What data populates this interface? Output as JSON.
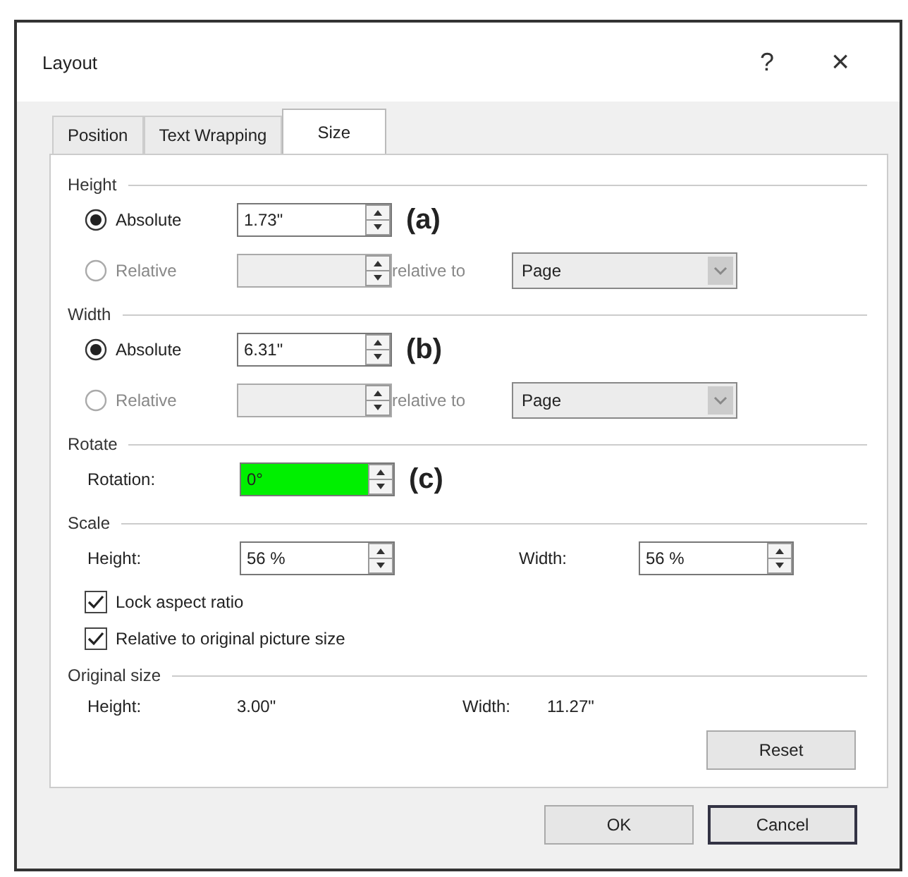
{
  "window": {
    "title": "Layout",
    "help": "?",
    "close": "×"
  },
  "tabs": [
    {
      "label": "Position",
      "selected": false
    },
    {
      "label": "Text Wrapping",
      "selected": false
    },
    {
      "label": "Size",
      "selected": true
    }
  ],
  "sections": [
    {
      "kind": "size",
      "title": "Height",
      "annotation": "(a)",
      "absolute": {
        "label": "Absolute",
        "selected": true,
        "value": "1.73\""
      },
      "relative": {
        "label": "Relative",
        "selected": false,
        "disabled": true
      },
      "relative_to": {
        "label": "relative to",
        "value": "Page",
        "disabled": true
      }
    },
    {
      "kind": "size",
      "title": "Width",
      "annotation": "(b)",
      "absolute": {
        "label": "Absolute",
        "selected": true,
        "value": "6.31\""
      },
      "relative": {
        "label": "Relative",
        "selected": false,
        "disabled": true
      },
      "relative_to": {
        "label": "relative to",
        "value": "Page",
        "disabled": true
      }
    },
    {
      "kind": "rotate",
      "title": "Rotate",
      "annotation": "(c)",
      "label": "Rotation:",
      "value": "0°",
      "highlighted": true
    },
    {
      "kind": "scale",
      "title": "Scale",
      "fields": [
        {
          "label": "Height:",
          "value": "56 %"
        },
        {
          "label": "Width:",
          "value": "56 %"
        }
      ],
      "checkboxes": [
        {
          "label": "Lock aspect ratio",
          "checked": true
        },
        {
          "label": "Relative to original picture size",
          "checked": true
        }
      ]
    },
    {
      "kind": "original",
      "title": "Original size",
      "items": [
        {
          "label": "Height:",
          "value": "3.00\""
        },
        {
          "label": "Width:",
          "value": "11.27\""
        }
      ],
      "button": "Reset"
    }
  ],
  "buttons": [
    {
      "label": "OK",
      "focused": false
    },
    {
      "label": "Cancel",
      "focused": true
    }
  ]
}
